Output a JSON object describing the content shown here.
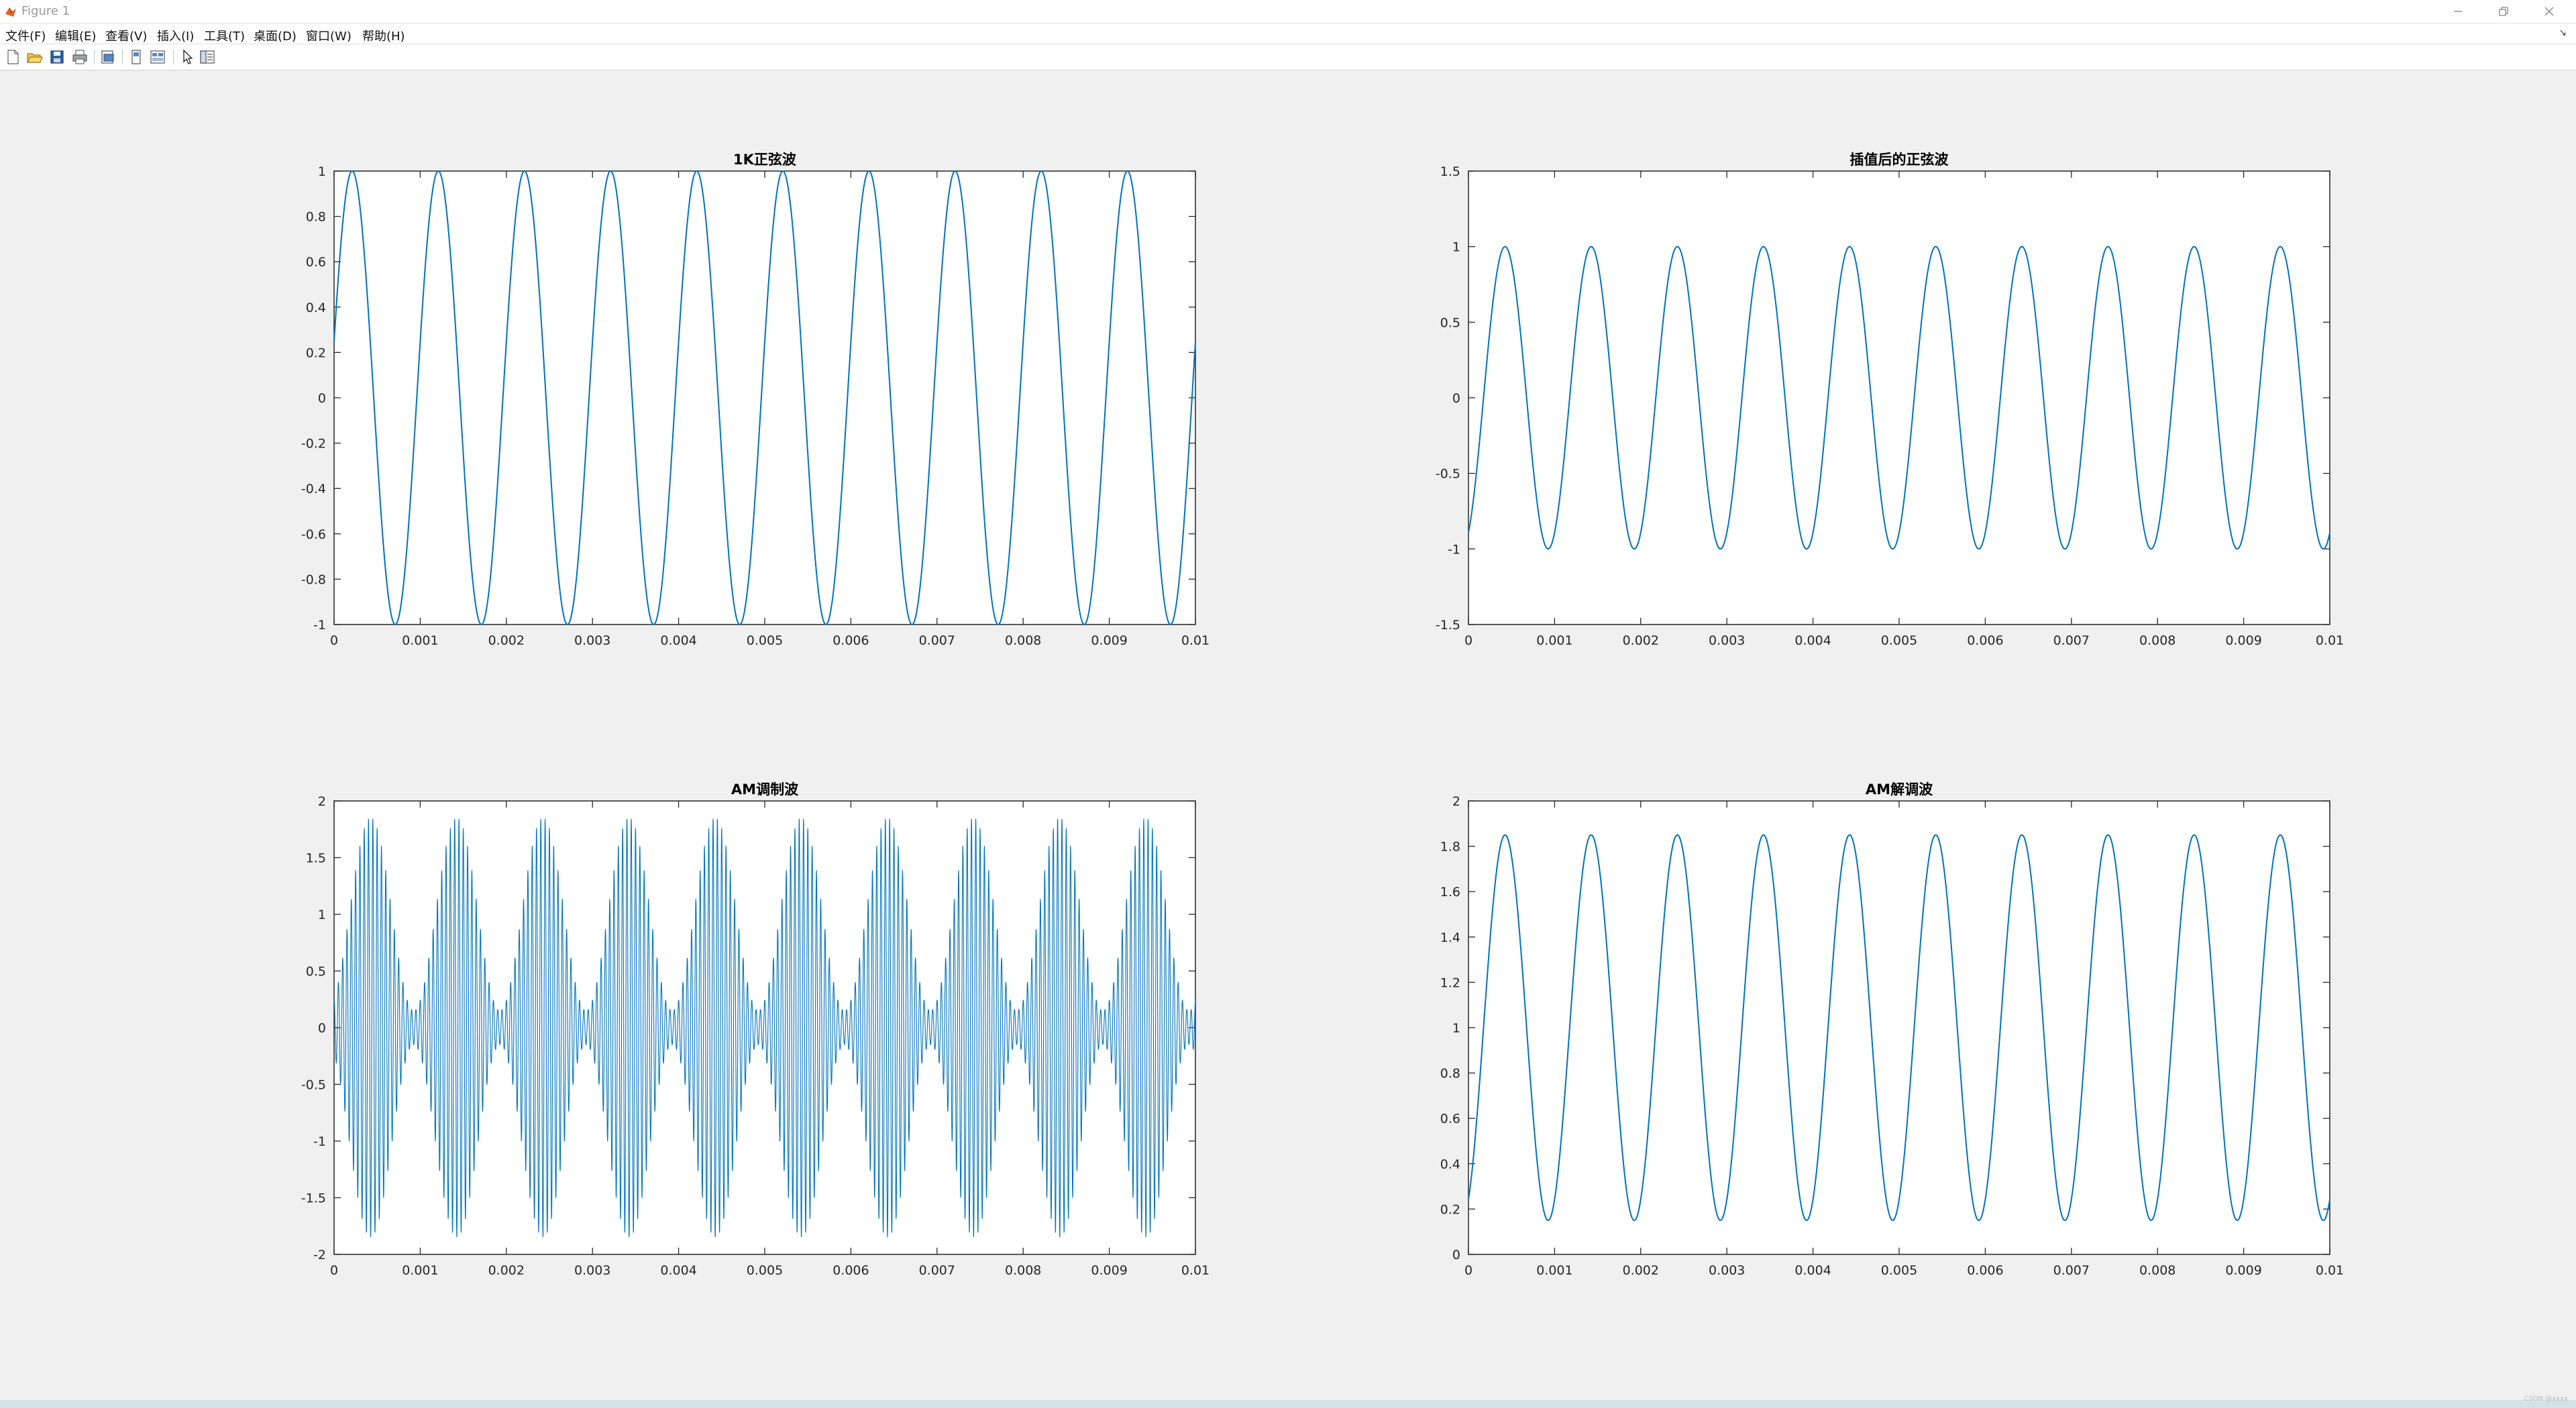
{
  "window": {
    "title": "Figure 1"
  },
  "menu": {
    "items": [
      "文件(F)",
      "编辑(E)",
      "查看(V)",
      "插入(I)",
      "工具(T)",
      "桌面(D)",
      "窗口(W)",
      "帮助(H)"
    ]
  },
  "toolbar": {
    "buttons": [
      "new-figure-icon",
      "open-file-icon",
      "save-icon",
      "print-icon",
      "print-preview-icon",
      "hide-toolbar-icon",
      "property-editor-icon",
      "edit-plot-pointer-icon",
      "open-property-inspector-icon"
    ]
  },
  "colors": {
    "line": "#0072BD",
    "axes_bg": "#ffffff",
    "figure_bg": "#f0f0f0"
  },
  "watermark": "CSDN @xxxx",
  "chart_data": [
    {
      "type": "line",
      "title": "1K正弦波",
      "xlim": [
        0,
        0.01
      ],
      "ylim": [
        -1,
        1
      ],
      "xticks": [
        "0",
        "0.001",
        "0.002",
        "0.003",
        "0.004",
        "0.005",
        "0.006",
        "0.007",
        "0.008",
        "0.009",
        "0.01"
      ],
      "yticks": [
        "-1",
        "-0.8",
        "-0.6",
        "-0.4",
        "-0.2",
        "0",
        "0.2",
        "0.4",
        "0.6",
        "0.8",
        "1"
      ],
      "series": [
        {
          "kind": "sine",
          "amplitude": 1,
          "offset": 0,
          "frequency_hz": 1000,
          "phase_rad": 0.25
        }
      ]
    },
    {
      "type": "line",
      "title": "插值后的正弦波",
      "xlim": [
        0,
        0.01
      ],
      "ylim": [
        -1.5,
        1.5
      ],
      "xticks": [
        "0",
        "0.001",
        "0.002",
        "0.003",
        "0.004",
        "0.005",
        "0.006",
        "0.007",
        "0.008",
        "0.009",
        "0.01"
      ],
      "yticks": [
        "-1.5",
        "-1",
        "-0.5",
        "0",
        "0.5",
        "1",
        "1.5"
      ],
      "series": [
        {
          "kind": "sine",
          "amplitude": 1,
          "offset": 0,
          "frequency_hz": 1000,
          "phase_rad": -1.1
        }
      ]
    },
    {
      "type": "line",
      "title": "AM调制波",
      "xlim": [
        0,
        0.01
      ],
      "ylim": [
        -2,
        2
      ],
      "xticks": [
        "0",
        "0.001",
        "0.002",
        "0.003",
        "0.004",
        "0.005",
        "0.006",
        "0.007",
        "0.008",
        "0.009",
        "0.01"
      ],
      "yticks": [
        "-2",
        "-1.5",
        "-1",
        "-0.5",
        "0",
        "0.5",
        "1",
        "1.5",
        "2"
      ],
      "series": [
        {
          "kind": "am",
          "carrier_offset": 1,
          "modulation_amplitude": 0.85,
          "frequency_hz": 1000,
          "phase_rad": -1.1,
          "carrier_hz": 20000
        }
      ]
    },
    {
      "type": "line",
      "title": "AM解调波",
      "xlim": [
        0,
        0.01
      ],
      "ylim": [
        0,
        2
      ],
      "xticks": [
        "0",
        "0.001",
        "0.002",
        "0.003",
        "0.004",
        "0.005",
        "0.006",
        "0.007",
        "0.008",
        "0.009",
        "0.01"
      ],
      "yticks": [
        "0",
        "0.2",
        "0.4",
        "0.6",
        "0.8",
        "1",
        "1.2",
        "1.4",
        "1.6",
        "1.8",
        "2"
      ],
      "series": [
        {
          "kind": "sine",
          "amplitude": 0.85,
          "offset": 1,
          "frequency_hz": 1000,
          "phase_rad": -1.1
        }
      ]
    }
  ]
}
